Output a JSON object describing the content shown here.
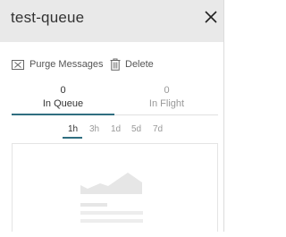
{
  "header": {
    "title": "test-queue",
    "close_icon": "close-icon"
  },
  "actions": {
    "purge_label": "Purge Messages",
    "purge_icon": "purge-icon",
    "delete_label": "Delete",
    "delete_icon": "trash-icon"
  },
  "tabs": [
    {
      "count": "0",
      "label": "In Queue",
      "active": true
    },
    {
      "count": "0",
      "label": "In Flight",
      "active": false
    }
  ],
  "ranges": [
    {
      "label": "1h",
      "active": true
    },
    {
      "label": "3h",
      "active": false
    },
    {
      "label": "1d",
      "active": false
    },
    {
      "label": "5d",
      "active": false
    },
    {
      "label": "7d",
      "active": false
    }
  ],
  "colors": {
    "accent": "#2f6e80",
    "header_bg": "#e9e9e9",
    "placeholder": "#e6e6e6"
  }
}
